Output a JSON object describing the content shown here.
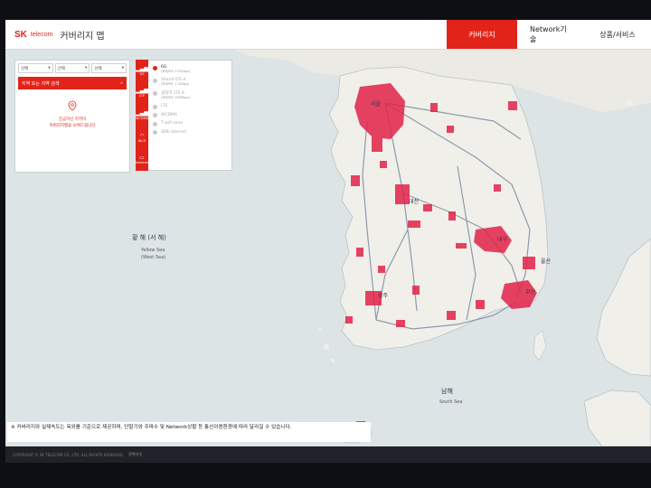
{
  "header": {
    "brand_sk": "SK",
    "brand_telecom": "telecom",
    "title": "커버리지 맵",
    "nav": [
      {
        "label": "커버리지",
        "active": true
      },
      {
        "label": "Network기술",
        "active": false
      },
      {
        "label": "상품/서비스",
        "active": false
      }
    ]
  },
  "search_panel": {
    "region_selects": [
      "선택",
      "선택",
      "선택"
    ],
    "search_placeholder": "지역 또는 지역 검색",
    "empty_line1": "궁금하신 지역이",
    "empty_line2": "커버리지맵을 보여드립니다"
  },
  "network_tabs": [
    {
      "label": "5G",
      "icon": "signal-icon",
      "active": false
    },
    {
      "label": "LTE",
      "icon": "signal-icon",
      "active": true
    },
    {
      "label": "WCDMA",
      "icon": "signal-icon",
      "active": false
    },
    {
      "label": "Wi-Fi",
      "icon": "wifi-icon",
      "active": false
    },
    {
      "label": "Internet",
      "icon": "monitor-icon",
      "active": false
    }
  ],
  "legend": [
    {
      "label": "6G",
      "sub": "(최대속도 270Gbps)",
      "color": "#e2231a",
      "dim": false
    },
    {
      "label": "5band LTE-A",
      "sub": "(최대속도 1.2Gbps)",
      "color": "#c9c9c9",
      "dim": true
    },
    {
      "label": "광대역 LTE-A",
      "sub": "(최대속도 300Mbps)",
      "color": "#c9c9c9",
      "dim": true
    },
    {
      "label": "LTE",
      "sub": "",
      "color": "#c9c9c9",
      "dim": true
    },
    {
      "label": "WCDMA",
      "sub": "",
      "color": "#c9c9c9",
      "dim": true
    },
    {
      "label": "T wifi zone",
      "sub": "",
      "color": "#c9c9c9",
      "dim": true
    },
    {
      "label": "SKB internet",
      "sub": "",
      "color": "#c9c9c9",
      "dim": true
    }
  ],
  "map_labels": {
    "yellow_sea_ko": "황 해 (서 해)",
    "yellow_sea_en": "Yellow Sea",
    "yellow_sea_en2": "(West Sea)",
    "south_sea_ko": "남해",
    "south_sea_en": "South Sea",
    "seoul": "서울",
    "busan": "부산",
    "daejeon": "대전",
    "gwangju": "광주",
    "daegu": "대구",
    "ulsan": "울산"
  },
  "notice": "※ 커버리지와 실제속도는 옥외를 기준으로 제공하며, 단말기와 주파수 및 Network상황 등 통신이용환경에 따라 달라질 수 있습니다.",
  "footer": {
    "copyright": "COPYRIGHT © SK TELECOM CO., LTD. ALL RIGHTS RESERVED",
    "policy": "정책안내"
  },
  "colors": {
    "brand": "#e2231a",
    "sea": "#dde4e6",
    "land": "#f1efe9",
    "coverage": "#e2234a"
  }
}
